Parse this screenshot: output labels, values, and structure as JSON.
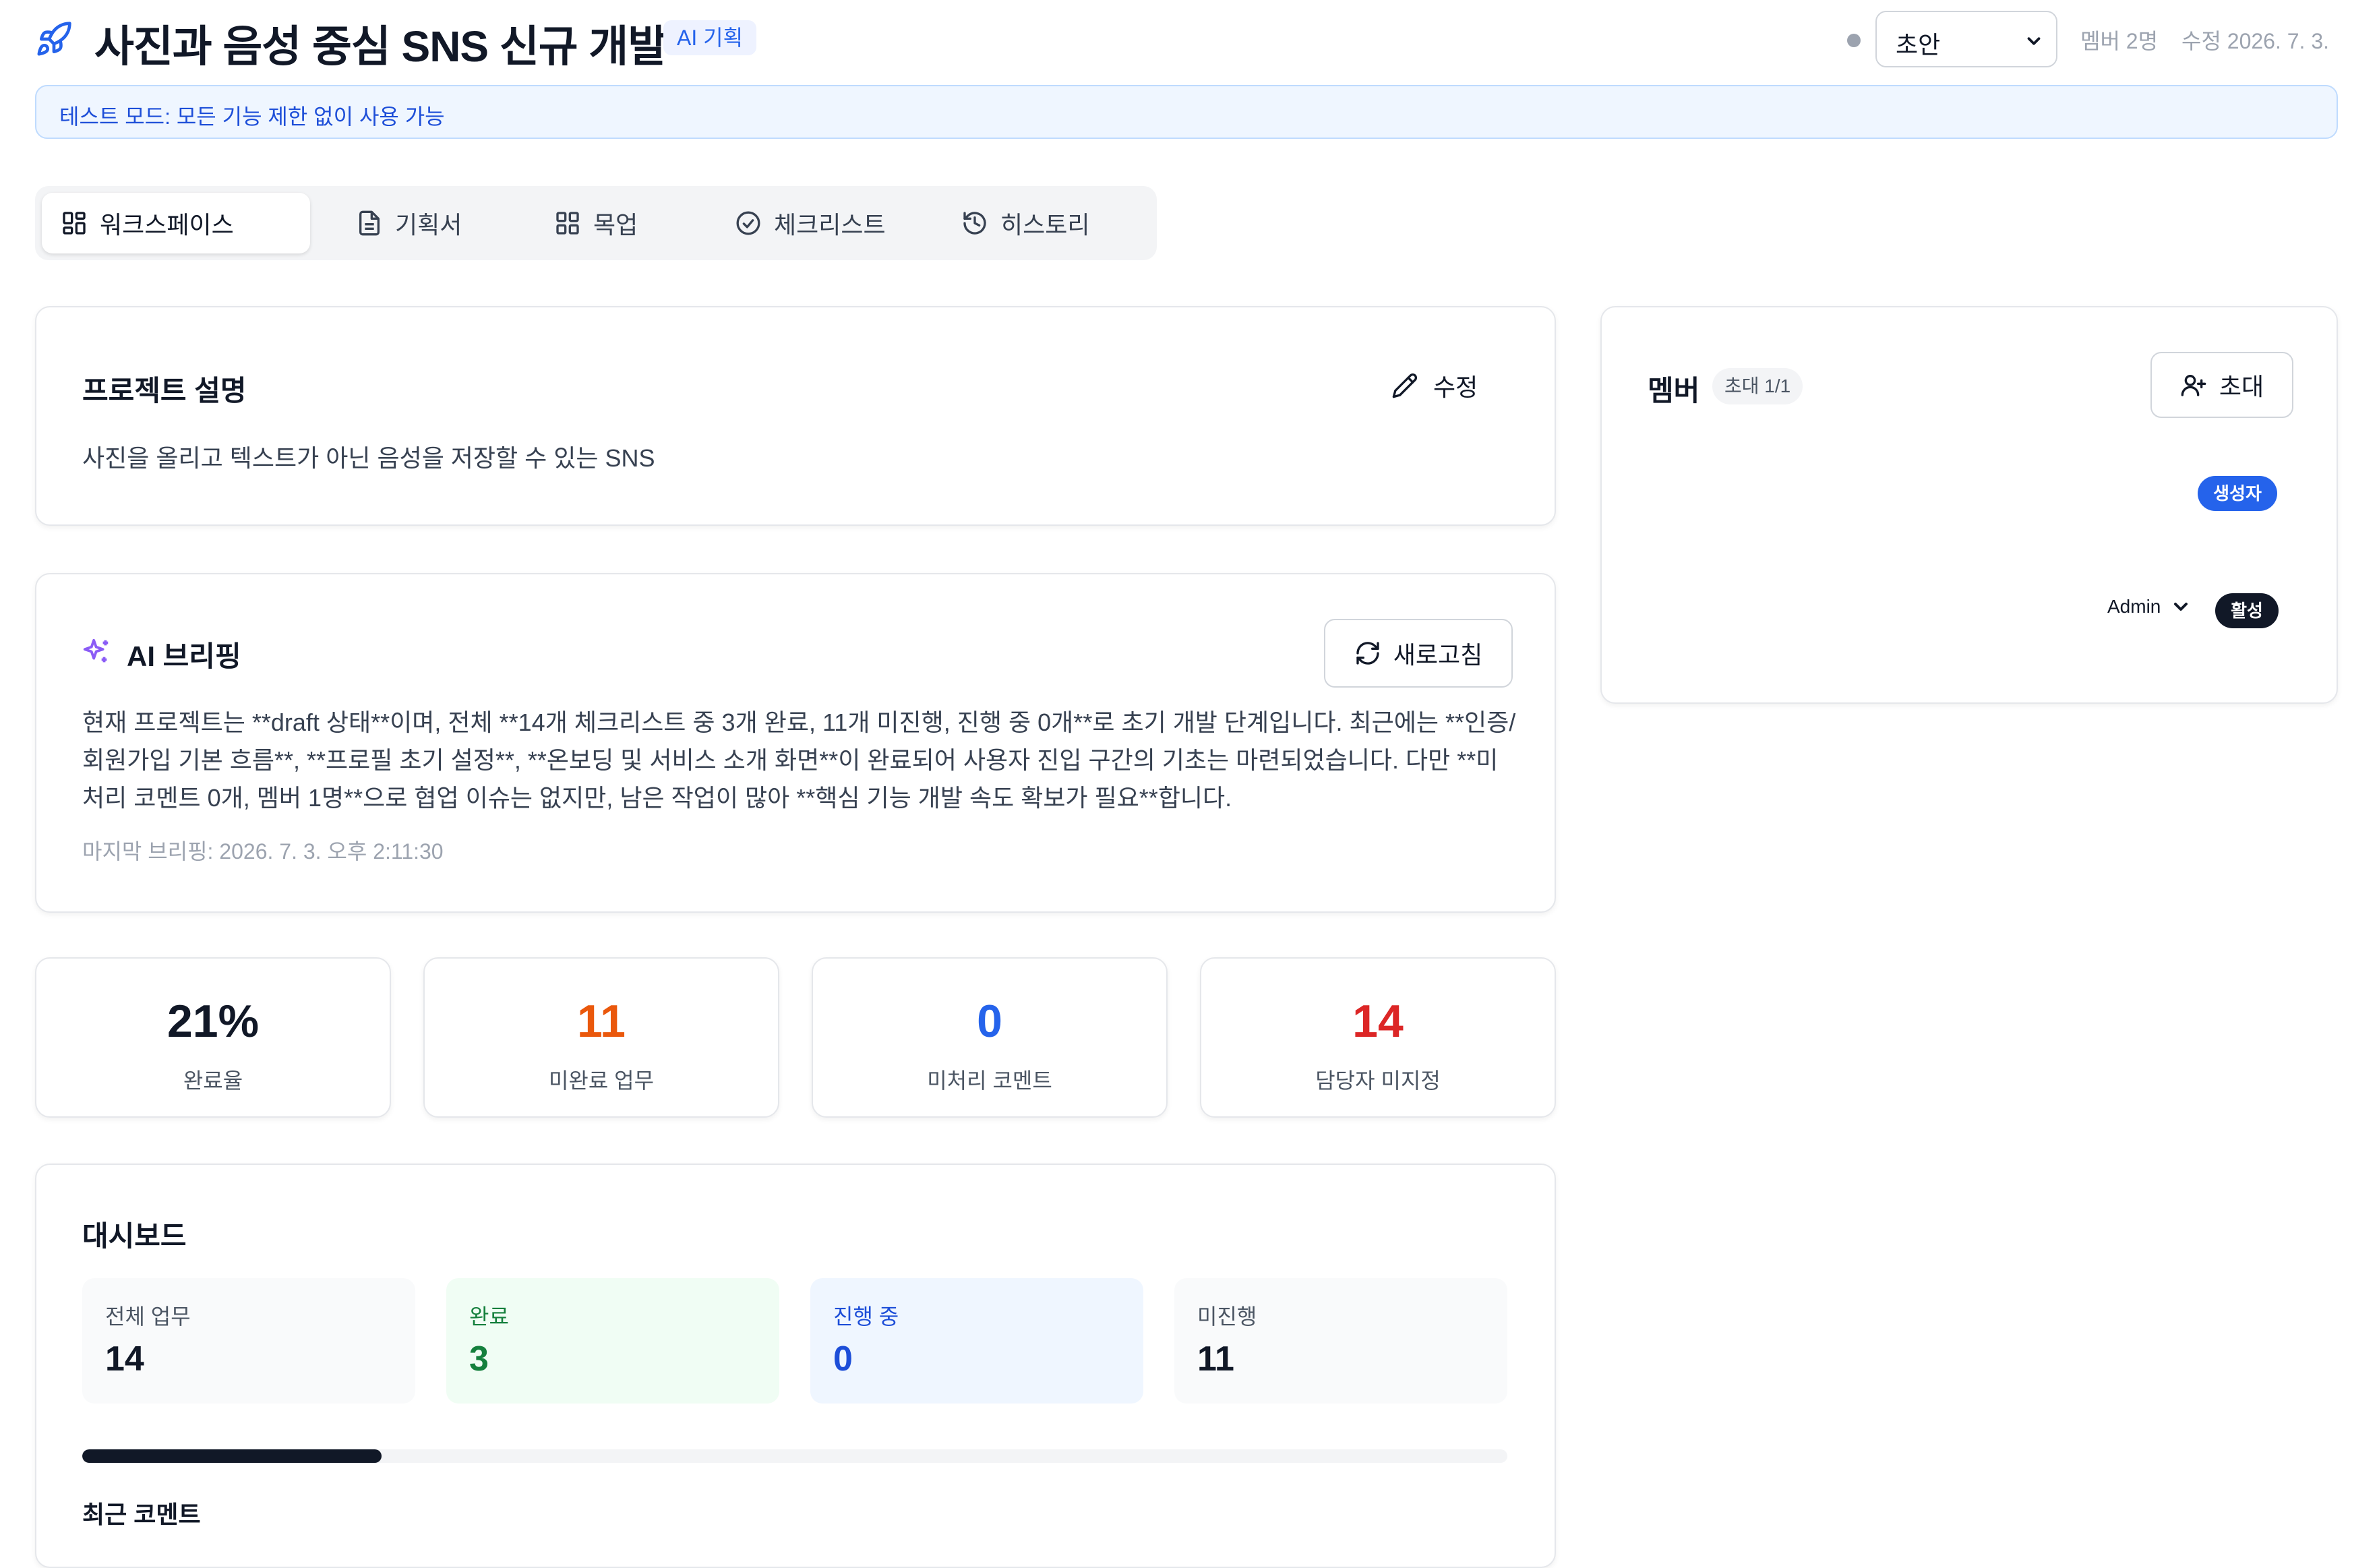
{
  "header": {
    "title": "사진과 음성 중심 SNS 신규 개발",
    "ai_badge": "AI 기획",
    "status_selected": "초안",
    "member_count": "멤버 2명",
    "modified": "수정 2026. 7. 3."
  },
  "banner": {
    "text": "테스트 모드: 모든 기능 제한 없이 사용 가능"
  },
  "tabs": [
    {
      "label": "워크스페이스",
      "icon": "grid-icon",
      "active": true
    },
    {
      "label": "기획서",
      "icon": "document-icon",
      "active": false
    },
    {
      "label": "목업",
      "icon": "grid-icon",
      "active": false
    },
    {
      "label": "체크리스트",
      "icon": "check-circle-icon",
      "active": false
    },
    {
      "label": "히스토리",
      "icon": "history-icon",
      "active": false
    }
  ],
  "description": {
    "title": "프로젝트 설명",
    "edit_label": "수정",
    "text": "사진을 올리고 텍스트가 아닌 음성을 저장할 수 있는 SNS"
  },
  "briefing": {
    "title": "AI 브리핑",
    "refresh_label": "새로고침",
    "text": "현재 프로젝트는 **draft 상태**이며, 전체 **14개 체크리스트 중 3개 완료, 11개 미진행, 진행 중 0개**로 초기 개발 단계입니다. 최근에는 **인증/회원가입 기본 흐름**, **프로필 초기 설정**, **온보딩 및 서비스 소개 화면**이 완료되어 사용자 진입 구간의 기초는 마련되었습니다. 다만 **미처리 코멘트 0개, 멤버 1명**으로 협업 이슈는 없지만, 남은 작업이 많아 **핵심 기능 개발 속도 확보가 필요**합니다.",
    "last_briefing": "마지막 브리핑: 2026. 7. 3. 오후 2:11:30"
  },
  "stats": [
    {
      "value": "21%",
      "label": "완료율",
      "color": "#111827"
    },
    {
      "value": "11",
      "label": "미완료 업무",
      "color": "#ea580c"
    },
    {
      "value": "0",
      "label": "미처리 코멘트",
      "color": "#2563eb"
    },
    {
      "value": "14",
      "label": "담당자 미지정",
      "color": "#dc2626"
    }
  ],
  "dashboard": {
    "title": "대시보드",
    "tiles": [
      {
        "label": "전체 업무",
        "value": "14",
        "bg": "#f9fafb",
        "label_color": "#4b5563",
        "value_color": "#111827"
      },
      {
        "label": "완료",
        "value": "3",
        "bg": "#f0fdf4",
        "label_color": "#15803d",
        "value_color": "#15803d"
      },
      {
        "label": "진행 중",
        "value": "0",
        "bg": "#eff6ff",
        "label_color": "#1d4ed8",
        "value_color": "#1d4ed8"
      },
      {
        "label": "미진행",
        "value": "11",
        "bg": "#f9fafb",
        "label_color": "#4b5563",
        "value_color": "#111827"
      }
    ],
    "progress": 0.21,
    "recent_comments_title": "최근 코멘트"
  },
  "members": {
    "title": "멤버",
    "invite_count": "초대 1/1",
    "invite_label": "초대",
    "creator_badge": "생성자",
    "role_selected": "Admin",
    "active_badge": "활성"
  },
  "colors": {
    "accent": "#2563eb",
    "dark": "#111827",
    "sparkle": "#8b5cf6"
  }
}
